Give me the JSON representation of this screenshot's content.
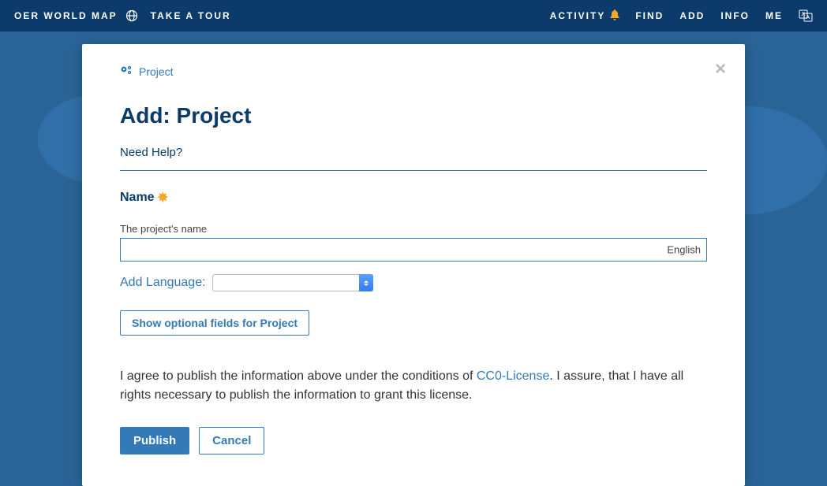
{
  "nav": {
    "brand": "OER WORLD MAP",
    "tour": "TAKE A TOUR",
    "activity": "ACTIVITY",
    "find": "FIND",
    "add": "ADD",
    "info": "INFO",
    "me": "ME"
  },
  "modal": {
    "crumb": "Project",
    "title": "Add: Project",
    "help": "Need Help?",
    "name_label": "Name",
    "name_hint": "The project's name",
    "name_value": "",
    "name_lang": "English",
    "add_language_label": "Add Language:",
    "optional_button": "Show optional fields for Project",
    "agreement_prefix": "I agree to publish the information above under the conditions of ",
    "agreement_link": "CC0-License",
    "agreement_suffix": ". I assure, that I have all rights necessary to publish the information to grant this license.",
    "publish": "Publish",
    "cancel": "Cancel"
  }
}
